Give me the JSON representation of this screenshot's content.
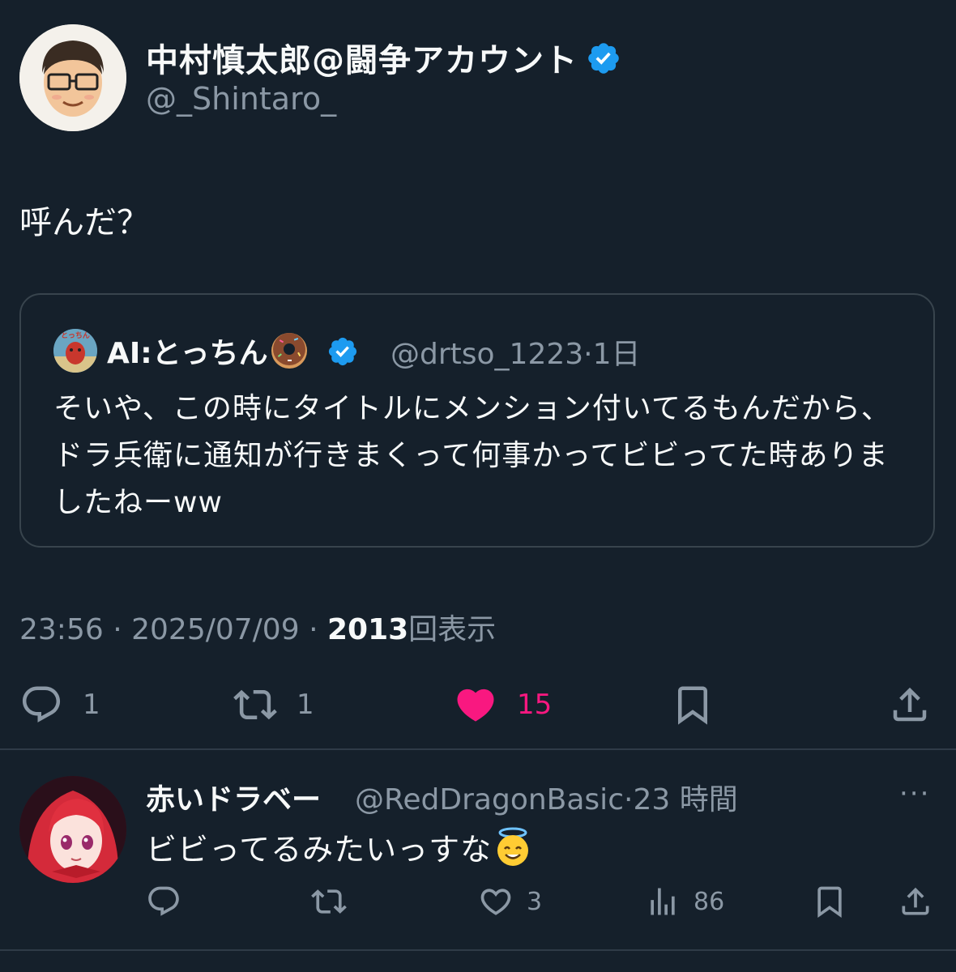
{
  "tweet": {
    "author_name": "中村慎太郎@闘争アカウント",
    "author_handle": "@_Shintaro_",
    "text": "呼んだ？",
    "quote": {
      "name": "AI:とっちん",
      "handle": "@drtso_1223",
      "separator": "·",
      "time": "1日",
      "text": "そいや、この時にタイトルにメンション付いてるもんだから、ドラ兵衛に通知が行きまくって何事かってビビってた時ありましたねーww",
      "avatar_label": "とっちん"
    },
    "time": "23:56",
    "separator": "·",
    "date": "2025/07/09",
    "views_count": "2013",
    "views_label": "回表示",
    "replies": "1",
    "retweets": "1",
    "likes": "15"
  },
  "reply": {
    "author_name": "赤いドラベー",
    "author_handle": "@RedDragonBasic",
    "separator": "·",
    "time": "23 時間",
    "text": "ビビってるみたいっすな",
    "more": "···",
    "likes": "3",
    "views": "86"
  },
  "colors": {
    "background": "#15202b",
    "text": "#f7f9f9",
    "muted": "#8b98a5",
    "verified": "#1d9bf0",
    "like_active": "#f91880",
    "border": "#38444d"
  },
  "icons": {
    "reply": "speech-bubble-icon",
    "retweet": "retweet-icon",
    "like": "heart-icon",
    "bookmark": "bookmark-icon",
    "share": "share-icon",
    "views": "bar-chart-icon",
    "verified": "verified-badge-icon"
  }
}
